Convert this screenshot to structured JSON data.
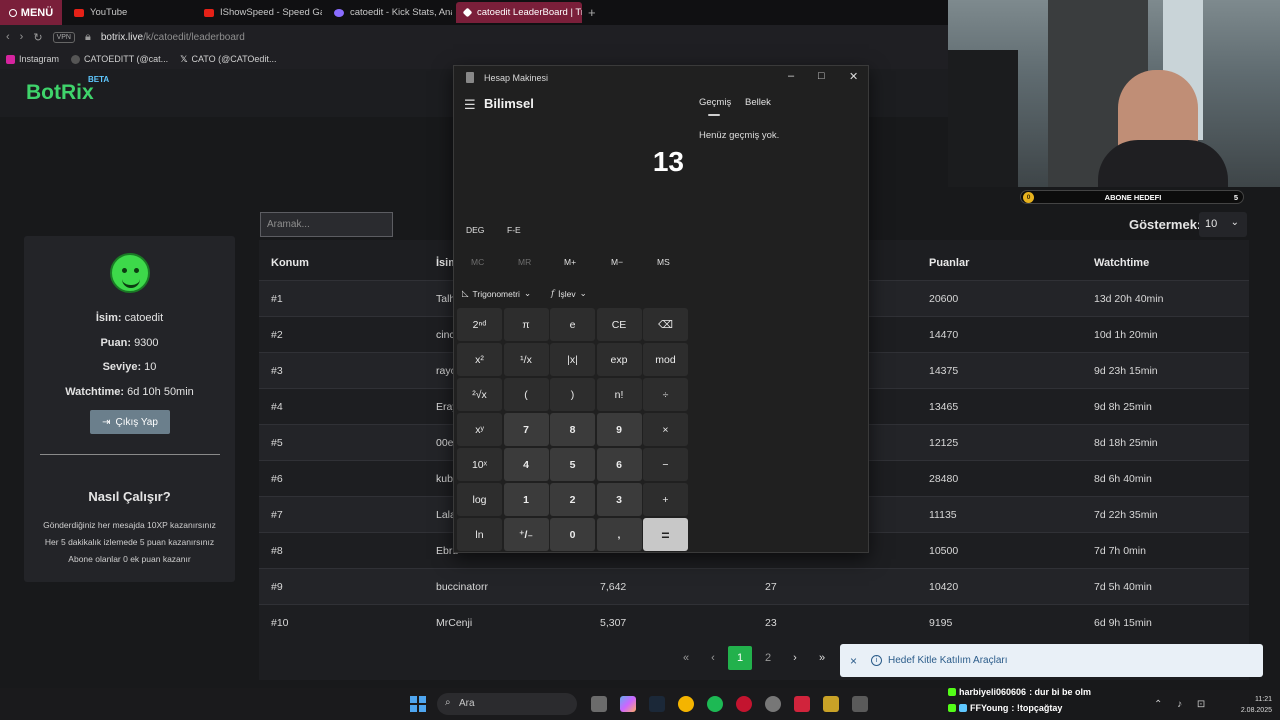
{
  "browser": {
    "menu_label": "MENÜ",
    "tabs": [
      {
        "label": "YouTube",
        "color": "#e62117"
      },
      {
        "label": "IShowSpeed - Speed Ga",
        "color": "#e62117"
      },
      {
        "label": "catoedit - Kick Stats, Ana",
        "color": "#8a6cff"
      },
      {
        "label": "catoedit LeaderBoard | Tr",
        "color": "#ffffff"
      }
    ],
    "new_tab": "+",
    "vpn": "VPN",
    "url_host": "botrix.live",
    "url_path": "/k/catoedit/leaderboard",
    "bookmarks": [
      {
        "label": "Instagram",
        "color": "#d6249f"
      },
      {
        "label": "CATOEDITT (@cat...",
        "color": "#333"
      },
      {
        "label": "CATO (@CATOedit...",
        "color": "#000"
      }
    ]
  },
  "site": {
    "logo": "BotRix",
    "logo_badge": "BETA",
    "search_placeholder": "Aramak...",
    "show_label": "Göstermek:",
    "show_value": "10",
    "profile": {
      "name_label": "İsim:",
      "name": "catoedit",
      "points_label": "Puan:",
      "points": "9300",
      "level_label": "Seviye:",
      "level": "10",
      "watch_label": "Watchtime:",
      "watch": "6d 10h 50min",
      "logout": "Çıkış Yap"
    },
    "how": {
      "title": "Nasıl Çalışır?",
      "lines": [
        "Gönderdiğiniz her mesajda 10XP kazanırsınız",
        "Her 5 dakikalık izlemede 5 puan kazanırsınız",
        "Abone olanlar 0 ek puan kazanır"
      ]
    },
    "table": {
      "headers": {
        "rank": "Konum",
        "name": "İsim",
        "points": "Puanlar",
        "watch": "Watchtime"
      },
      "rows": [
        {
          "rank": "#1",
          "name": "Talh",
          "c3": "",
          "c4": "",
          "points": "20600",
          "watch": "13d 20h 40min"
        },
        {
          "rank": "#2",
          "name": "cinc",
          "c3": "",
          "c4": "",
          "points": "14470",
          "watch": "10d 1h 20min"
        },
        {
          "rank": "#3",
          "name": "rayo",
          "c3": "",
          "c4": "",
          "points": "14375",
          "watch": "9d 23h 15min"
        },
        {
          "rank": "#4",
          "name": "Eray",
          "c3": "",
          "c4": "",
          "points": "13465",
          "watch": "9d 8h 25min"
        },
        {
          "rank": "#5",
          "name": "00e",
          "c3": "",
          "c4": "",
          "points": "12125",
          "watch": "8d 18h 25min"
        },
        {
          "rank": "#6",
          "name": "kub",
          "c3": "",
          "c4": "",
          "points": "28480",
          "watch": "8d 6h 40min"
        },
        {
          "rank": "#7",
          "name": "Lala",
          "c3": "",
          "c4": "",
          "points": "11135",
          "watch": "7d 22h 35min"
        },
        {
          "rank": "#8",
          "name": "Ebru",
          "c3": "",
          "c4": "",
          "points": "10500",
          "watch": "7d 7h 0min"
        },
        {
          "rank": "#9",
          "name": "buccinatorr",
          "c3": "7,642",
          "c4": "27",
          "points": "10420",
          "watch": "7d 5h 40min"
        },
        {
          "rank": "#10",
          "name": "MrCenji",
          "c3": "5,307",
          "c4": "23",
          "points": "9195",
          "watch": "6d 9h 15min"
        }
      ]
    },
    "pager": {
      "first": "«",
      "prev": "‹",
      "page1": "1",
      "page2": "2",
      "next": "›",
      "last": "»"
    },
    "toast": {
      "close": "×",
      "message": "Hedef Kitle Katılım Araçları"
    }
  },
  "calculator": {
    "title": "Hesap Makinesi",
    "mode": "Bilimsel",
    "history_tab": "Geçmiş",
    "memory_tab": "Bellek",
    "history_empty": "Henüz geçmiş yok.",
    "display": "13",
    "deg": "DEG",
    "fe": "F-E",
    "memory": [
      "MC",
      "MR",
      "M+",
      "M−",
      "MS"
    ],
    "trig": "Trigonometri",
    "func": "İşlev",
    "keys": [
      [
        "2ⁿᵈ",
        "π",
        "e",
        "CE",
        "⌫"
      ],
      [
        "x²",
        "¹/x",
        "|x|",
        "exp",
        "mod"
      ],
      [
        "²√x",
        "(",
        ")",
        "n!",
        "÷"
      ],
      [
        "xʸ",
        "7",
        "8",
        "9",
        "×"
      ],
      [
        "10ˣ",
        "4",
        "5",
        "6",
        "−"
      ],
      [
        "log",
        "1",
        "2",
        "3",
        "+"
      ],
      [
        "ln",
        "⁺/₋",
        "0",
        ",",
        "="
      ]
    ]
  },
  "overlay": {
    "goal_coin": "0",
    "goal_label": "ABONE HEDEFI",
    "goal_count": "5",
    "chat": [
      {
        "user": "harbiyeli060606",
        "text": ": dur bi be olm"
      },
      {
        "user": "FFYoung",
        "text": ": !topçağtay"
      }
    ]
  },
  "taskbar": {
    "search": "Ara",
    "time": "11:21",
    "date": "2.08.2025"
  }
}
